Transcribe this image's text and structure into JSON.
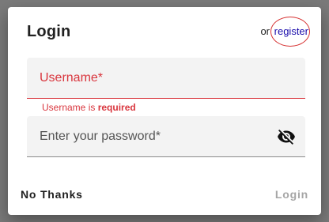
{
  "dialog": {
    "title": "Login",
    "or_text": "or",
    "register_label": "register"
  },
  "username": {
    "placeholder": "Username*",
    "value": "",
    "error_prefix": "Username is ",
    "error_emphasis": "required"
  },
  "password": {
    "placeholder": "Enter your password*",
    "value": "",
    "toggle_icon": "eye-off-icon"
  },
  "actions": {
    "no_thanks_label": "No Thanks",
    "login_label": "Login"
  },
  "colors": {
    "error": "#d9363e",
    "link": "#1a0dab",
    "disabled": "#a6a6a6"
  }
}
